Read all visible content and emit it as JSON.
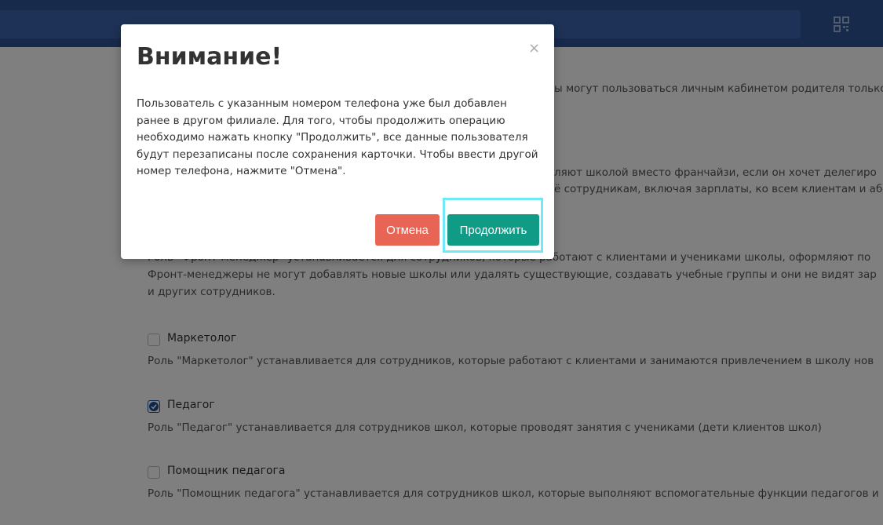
{
  "page": {
    "roles_intro_tail": "ы могут пользоваться личным кабинетом родителя только",
    "director_desc_1": "ляют школой вместо франчайзи, если он хочет делегиро",
    "director_desc_2": "ё сотрудникам, включая зарплаты, ко всем клиентам и аб",
    "front_desc_1": "Роль \"Фронт-менеджер\" устанавливается для сотрудников, которые работают с клиентами и учениками школы, оформляют по",
    "front_desc_2": "Фронт-менеджеры не могут добавлять новые школы или удалять существующие, создавать учебные группы и они не видят зар",
    "front_desc_3": "и других сотрудников.",
    "roles": [
      {
        "label": "Маркетолог",
        "checked": false,
        "description": "Роль \"Маркетолог\" устанавливается для сотрудников, которые работают с клиентами и занимаются привлечением в школу нов"
      },
      {
        "label": "Педагог",
        "checked": true,
        "description": "Роль \"Педагог\" устанавливается для сотрудников школ, которые проводят занятия с учениками (дети клиентов школ)"
      },
      {
        "label": "Помощник педагога",
        "checked": false,
        "description": "Роль \"Помощник педагога\" устанавливается для сотрудников школ, которые выполняют вспомогательные функции педагогов и"
      }
    ]
  },
  "modal": {
    "title": "Внимание!",
    "close": "×",
    "body": "Пользователь с указанным номером телефона уже был добавлен ранее в другом филиале. Для того, чтобы продолжить операцию необходимо нажать кнопку \"Продолжить\", все данные пользователя будут перезаписаны после сохранения карточки. Чтобы ввести другой номер телефона, нажмите \"Отмена\".",
    "cancel_label": "Отмена",
    "continue_label": "Продолжить"
  },
  "colors": {
    "topbar": "#2f5597",
    "cancel": "#e86455",
    "continue": "#0f9b86",
    "highlight": "#6fe8f7"
  },
  "icons": {
    "topbar_right": "qr-code-icon",
    "checkbox_checked": "check-icon"
  }
}
